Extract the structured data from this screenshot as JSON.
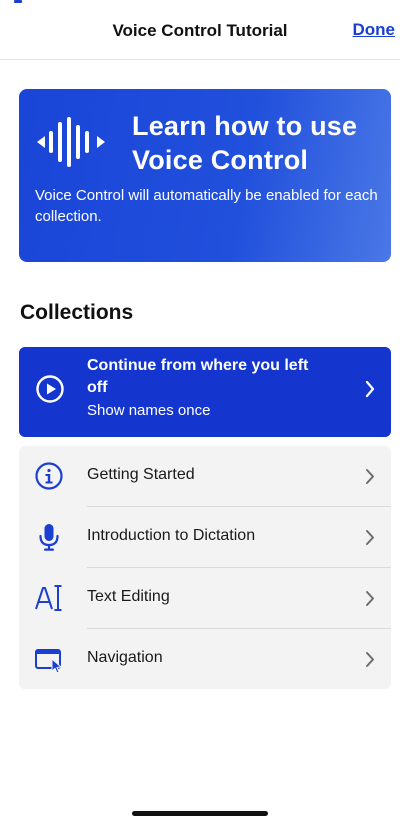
{
  "navbar": {
    "title": "Voice Control Tutorial",
    "done_label": "Done"
  },
  "hero": {
    "title_line1": "Learn how to use",
    "title_line2": "Voice Control",
    "description": "Voice Control will automatically be enabled for each collection.",
    "icon": "sound-wave-icon"
  },
  "collections": {
    "heading": "Collections",
    "continue": {
      "title": "Continue from where you left off",
      "subtitle": "Show names once",
      "icon": "play-circle-icon"
    },
    "items": [
      {
        "label": "Getting Started",
        "icon": "info-circle-icon"
      },
      {
        "label": "Introduction to Dictation",
        "icon": "microphone-icon"
      },
      {
        "label": "Text Editing",
        "icon": "text-cursor-icon"
      },
      {
        "label": "Navigation",
        "icon": "window-pointer-icon"
      }
    ]
  },
  "colors": {
    "accent": "#1a3fd1",
    "card_blue": "#1436cf",
    "list_bg": "#f3f3f4"
  }
}
